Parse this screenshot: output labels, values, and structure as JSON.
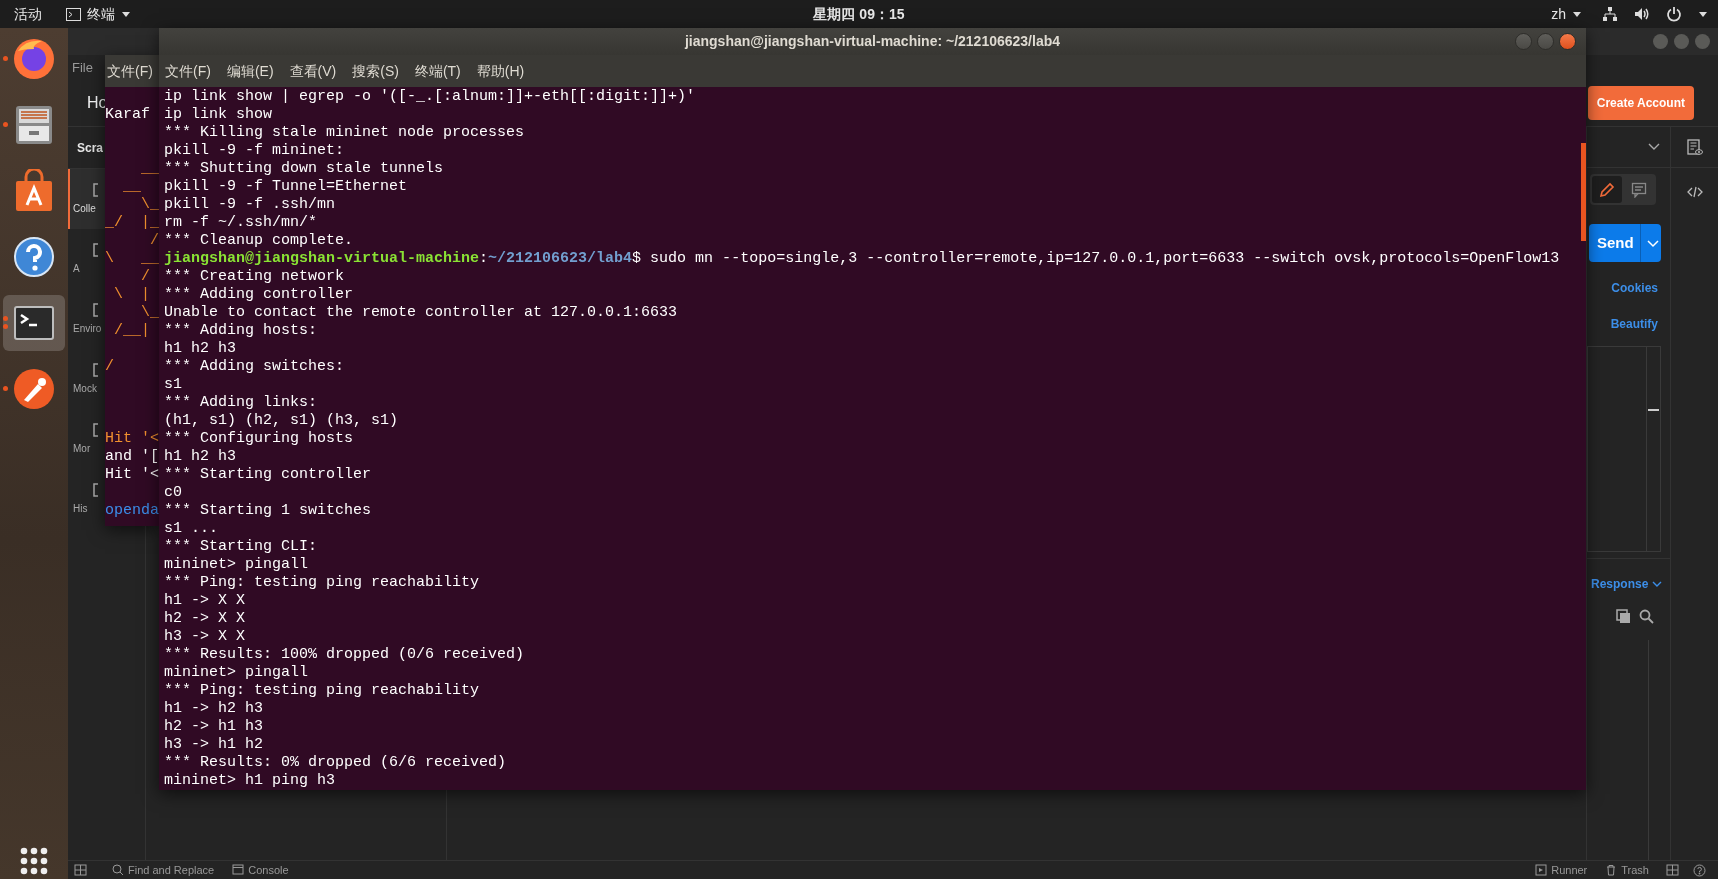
{
  "top_bar": {
    "activities": "活动",
    "app_menu": "终端",
    "clock": "星期四 09：15",
    "input_method": "zh"
  },
  "dock": {
    "apps": [
      {
        "kind": "firefox",
        "running": true,
        "multiple": false,
        "selected": false
      },
      {
        "kind": "files",
        "running": true,
        "multiple": false,
        "selected": false
      },
      {
        "kind": "software",
        "running": false,
        "selected": false
      },
      {
        "kind": "help",
        "running": false,
        "selected": false
      },
      {
        "kind": "terminal",
        "running": true,
        "multiple": true,
        "selected": true
      },
      {
        "kind": "postman",
        "running": true,
        "multiple": false,
        "selected": false
      }
    ]
  },
  "postman": {
    "menu": "File",
    "header_tab": "Ho",
    "create_account": "Create Account",
    "workspace": "Scra",
    "nav": [
      {
        "label": "Colle",
        "selected": true
      },
      {
        "label": "A",
        "selected": false
      },
      {
        "label": "Enviro",
        "selected": false
      },
      {
        "label": "Mock",
        "selected": false
      },
      {
        "label": "Mor",
        "selected": false
      },
      {
        "label": "His",
        "selected": false
      }
    ],
    "mode_buttons": [
      {
        "kind": "edit",
        "selected": true
      },
      {
        "kind": "comment",
        "selected": false
      }
    ],
    "send": "Send",
    "cookies": "Cookies",
    "beautify": "Beautify",
    "response": "Response",
    "status_left": [
      "Find and Replace",
      "Console"
    ],
    "status_right": [
      "Runner",
      "Trash"
    ]
  },
  "back_terminal": {
    "menu": "文件(F)",
    "lines": [
      {
        "kind": "blank"
      },
      {
        "kind": "plain",
        "text": "Karaf"
      },
      {
        "kind": "blank"
      },
      {
        "kind": "blank"
      },
      {
        "kind": "art",
        "text": "    __"
      },
      {
        "kind": "art",
        "text": "  __"
      },
      {
        "kind": "art",
        "text": "    \\_"
      },
      {
        "kind": "art",
        "text": "_/  |_"
      },
      {
        "kind": "art",
        "text": "     /"
      },
      {
        "kind": "art",
        "text": "\\   __"
      },
      {
        "kind": "art",
        "text": "    /"
      },
      {
        "kind": "art",
        "text": " \\  |"
      },
      {
        "kind": "art",
        "text": "    \\_"
      },
      {
        "kind": "art",
        "text": " /__|"
      },
      {
        "kind": "blank"
      },
      {
        "kind": "art",
        "text": "/"
      },
      {
        "kind": "blank"
      },
      {
        "kind": "blank"
      },
      {
        "kind": "blank"
      },
      {
        "kind": "art",
        "text": "Hit '<"
      },
      {
        "kind": "plain",
        "text": "and '["
      },
      {
        "kind": "plain",
        "text": "Hit '<"
      },
      {
        "kind": "blank"
      },
      {
        "kind": "link",
        "text": "openda"
      }
    ]
  },
  "terminal": {
    "title": "jiangshan@jiangshan-virtual-machine: ~/212106623/lab4",
    "menu": [
      "文件(F)",
      "编辑(E)",
      "查看(V)",
      "搜索(S)",
      "终端(T)",
      "帮助(H)"
    ],
    "lines": [
      {
        "kind": "output",
        "text": "ip link show | egrep -o '([-_.[:alnum:]]+-eth[[:digit:]]+)'"
      },
      {
        "kind": "output",
        "text": "ip link show"
      },
      {
        "kind": "output",
        "text": "*** Killing stale mininet node processes"
      },
      {
        "kind": "output",
        "text": "pkill -9 -f mininet:"
      },
      {
        "kind": "output",
        "text": "*** Shutting down stale tunnels"
      },
      {
        "kind": "output",
        "text": "pkill -9 -f Tunnel=Ethernet"
      },
      {
        "kind": "output",
        "text": "pkill -9 -f .ssh/mn"
      },
      {
        "kind": "output",
        "text": "rm -f ~/.ssh/mn/*"
      },
      {
        "kind": "output",
        "text": "*** Cleanup complete."
      },
      {
        "kind": "prompt",
        "segments": [
          {
            "kind": "user",
            "text": "jiangshan@jiangshan-virtual-machine"
          },
          {
            "kind": "plain",
            "text": ":"
          },
          {
            "kind": "path",
            "text": "~/212106623/lab4"
          },
          {
            "kind": "plain",
            "text": "$ sudo mn --topo=single,3 --controller=remote,ip=127.0.0.1,port=6633 --switch ovsk,protocols=OpenFlow13"
          }
        ]
      },
      {
        "kind": "output",
        "text": "*** Creating network"
      },
      {
        "kind": "output",
        "text": "*** Adding controller"
      },
      {
        "kind": "output",
        "text": "Unable to contact the remote controller at 127.0.0.1:6633"
      },
      {
        "kind": "output",
        "text": "*** Adding hosts:"
      },
      {
        "kind": "output",
        "text": "h1 h2 h3"
      },
      {
        "kind": "output",
        "text": "*** Adding switches:"
      },
      {
        "kind": "output",
        "text": "s1"
      },
      {
        "kind": "output",
        "text": "*** Adding links:"
      },
      {
        "kind": "output",
        "text": "(h1, s1) (h2, s1) (h3, s1)"
      },
      {
        "kind": "output",
        "text": "*** Configuring hosts"
      },
      {
        "kind": "output",
        "text": "h1 h2 h3"
      },
      {
        "kind": "output",
        "text": "*** Starting controller"
      },
      {
        "kind": "output",
        "text": "c0"
      },
      {
        "kind": "output",
        "text": "*** Starting 1 switches"
      },
      {
        "kind": "output",
        "text": "s1 ..."
      },
      {
        "kind": "output",
        "text": "*** Starting CLI:"
      },
      {
        "kind": "output",
        "text": "mininet> pingall"
      },
      {
        "kind": "output",
        "text": "*** Ping: testing ping reachability"
      },
      {
        "kind": "output",
        "text": "h1 -> X X"
      },
      {
        "kind": "output",
        "text": "h2 -> X X"
      },
      {
        "kind": "output",
        "text": "h3 -> X X"
      },
      {
        "kind": "output",
        "text": "*** Results: 100% dropped (0/6 received)"
      },
      {
        "kind": "output",
        "text": "mininet> pingall"
      },
      {
        "kind": "output",
        "text": "*** Ping: testing ping reachability"
      },
      {
        "kind": "output",
        "text": "h1 -> h2 h3"
      },
      {
        "kind": "output",
        "text": "h2 -> h1 h3"
      },
      {
        "kind": "output",
        "text": "h3 -> h1 h2"
      },
      {
        "kind": "output",
        "text": "*** Results: 0% dropped (6/6 received)"
      },
      {
        "kind": "output",
        "text": "mininet> h1 ping h3"
      }
    ]
  }
}
